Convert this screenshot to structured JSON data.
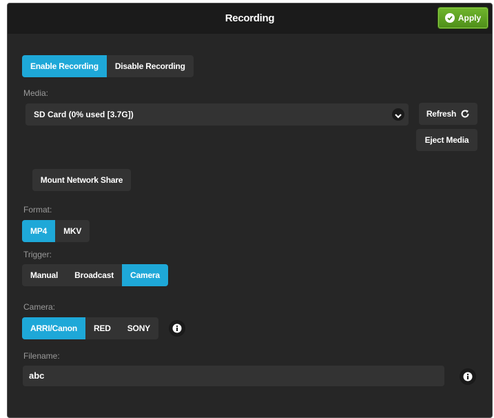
{
  "header": {
    "title": "Recording",
    "apply_label": "Apply"
  },
  "recording_toggle": {
    "options": [
      "Enable Recording",
      "Disable Recording"
    ],
    "selected": "Enable Recording"
  },
  "media": {
    "label": "Media:",
    "selected": "SD Card (0% used [3.7G])",
    "refresh_label": "Refresh",
    "eject_label": "Eject Media",
    "mount_label": "Mount Network Share"
  },
  "format": {
    "label": "Format:",
    "options": [
      "MP4",
      "MKV"
    ],
    "selected": "MP4"
  },
  "trigger": {
    "label": "Trigger:",
    "options": [
      "Manual",
      "Broadcast",
      "Camera"
    ],
    "selected": "Camera"
  },
  "camera": {
    "label": "Camera:",
    "options": [
      "ARRI/Canon",
      "RED",
      "SONY"
    ],
    "selected": "ARRI/Canon"
  },
  "filename": {
    "label": "Filename:",
    "value": "abc"
  },
  "colors": {
    "accent": "#1ea8d8",
    "apply_green": "#5ea322",
    "panel_bg": "#262626"
  },
  "icons": {
    "apply": "check-circle-icon",
    "refresh": "refresh-icon",
    "dropdown": "chevron-down-icon",
    "info": "info-icon"
  }
}
